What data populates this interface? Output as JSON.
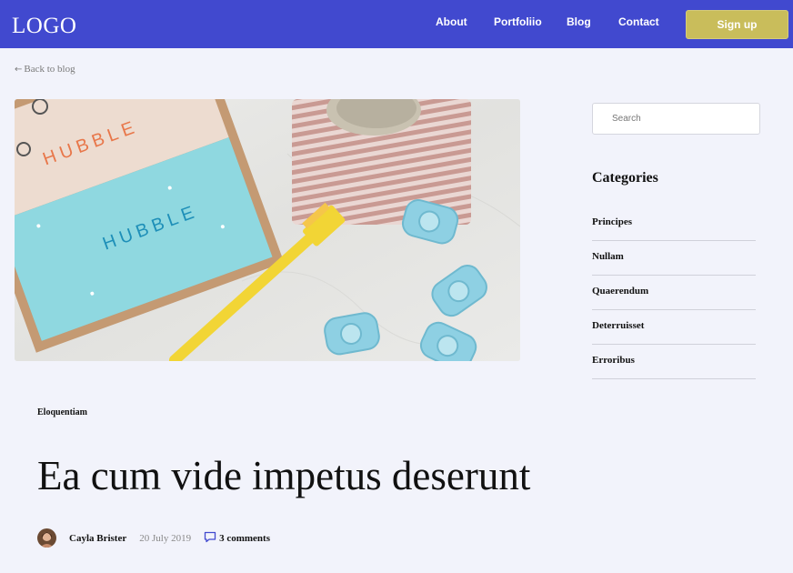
{
  "header": {
    "logo": "LOGO",
    "nav": [
      "About",
      "Portfoliio",
      "Blog",
      "Contact"
    ],
    "signup_label": "Sign up",
    "bg_color": "#4149cf",
    "signup_color": "#c9bd5b"
  },
  "back_link": "Back to blog",
  "hero_image": {
    "box_text_1": "HUBBLE",
    "box_text_2": "HUBBLE"
  },
  "sidebar": {
    "search_placeholder": "Search",
    "categories_title": "Categories",
    "categories": [
      "Principes",
      "Nullam",
      "Quaerendum",
      "Deterruisset",
      "Erroribus"
    ]
  },
  "post": {
    "tag": "Eloquentiam",
    "title": "Ea cum vide impetus deserunt",
    "author": "Cayla Brister",
    "date": "20 July 2019",
    "comments": "3 comments"
  }
}
